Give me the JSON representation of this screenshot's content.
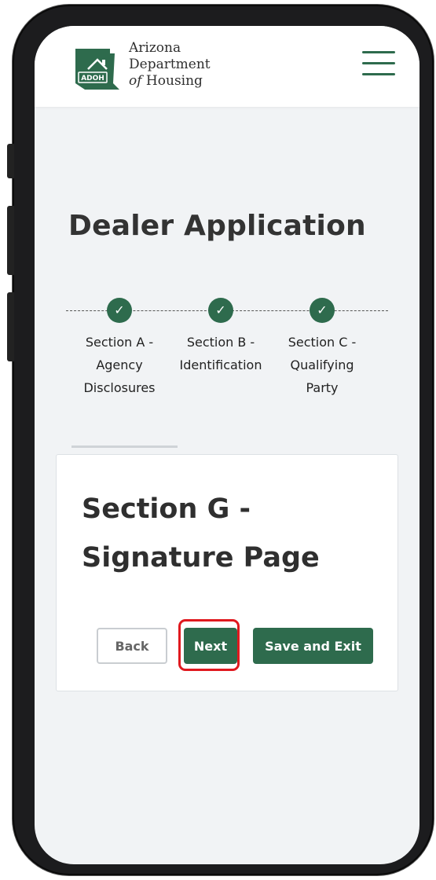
{
  "header": {
    "logo_abbr": "ADOH",
    "logo_line1": "Arizona",
    "logo_line2": "Department",
    "logo_line3_italic": "of",
    "logo_line3_rest": " Housing",
    "menu_icon": "hamburger-menu-icon"
  },
  "page": {
    "title": "Dealer Application"
  },
  "stepper": {
    "check_glyph": "✓",
    "steps": [
      {
        "line1": "Section A -",
        "line2": "Agency",
        "line3": "Disclosures",
        "status": "complete"
      },
      {
        "line1": "Section B -",
        "line2": "Identification",
        "line3": "",
        "status": "complete"
      },
      {
        "line1": "Section C -",
        "line2": "Qualifying",
        "line3": "Party",
        "status": "complete"
      }
    ]
  },
  "card": {
    "title_line1": "Section G -",
    "title_line2": "Signature Page",
    "back_label": "Back",
    "next_label": "Next",
    "save_label": "Save and Exit"
  },
  "colors": {
    "brand_green": "#2e6b4d",
    "highlight_red": "#e0191f",
    "background": "#f1f3f5"
  }
}
